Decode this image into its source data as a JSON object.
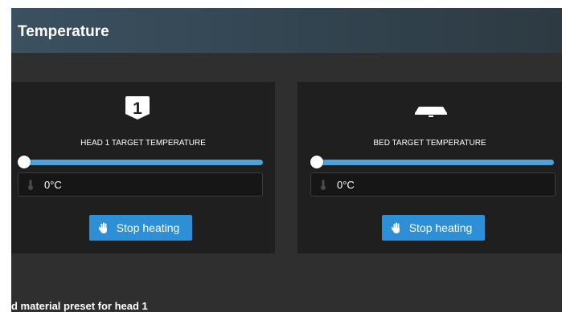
{
  "header": {
    "title": "Temperature"
  },
  "head_panel": {
    "icon": "head-1-badge-icon",
    "badge_number": "1",
    "title": "HEAD 1 TARGET TEMPERATURE",
    "slider_value": 0,
    "temperature": "0°C",
    "button_label": "Stop heating"
  },
  "bed_panel": {
    "icon": "bed-icon",
    "title": "BED TARGET TEMPERATURE",
    "slider_value": 0,
    "temperature": "0°C",
    "button_label": "Stop heating"
  },
  "footer": {
    "partial_text": "d material preset for head 1"
  },
  "colors": {
    "accent": "#2d8fd5",
    "slider": "#4aa2df",
    "panel_bg": "#1f1f1f",
    "page_bg": "#2f2f2f"
  }
}
